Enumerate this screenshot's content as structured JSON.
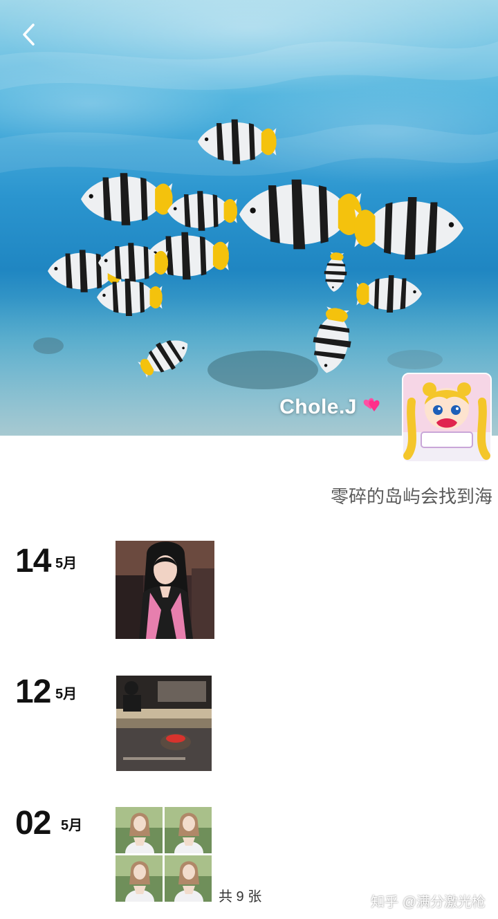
{
  "profile": {
    "nickname": "Chole.J",
    "signature": "零碎的岛屿会找到海"
  },
  "icons": {
    "back": "chevron-left-icon",
    "nickname_emoji": "two-hearts-icon"
  },
  "timeline": [
    {
      "day": "14",
      "month": "5月",
      "count_text": ""
    },
    {
      "day": "12",
      "month": "5月",
      "count_text": ""
    },
    {
      "day": "02",
      "month": "5月",
      "count_text": "共 9 张"
    }
  ],
  "watermark": "知乎 @满分激光枪",
  "colors": {
    "water": "#2b95cf",
    "fish_yellow": "#f4c20d",
    "text_primary": "#111111",
    "text_secondary": "#5a5a5a"
  }
}
